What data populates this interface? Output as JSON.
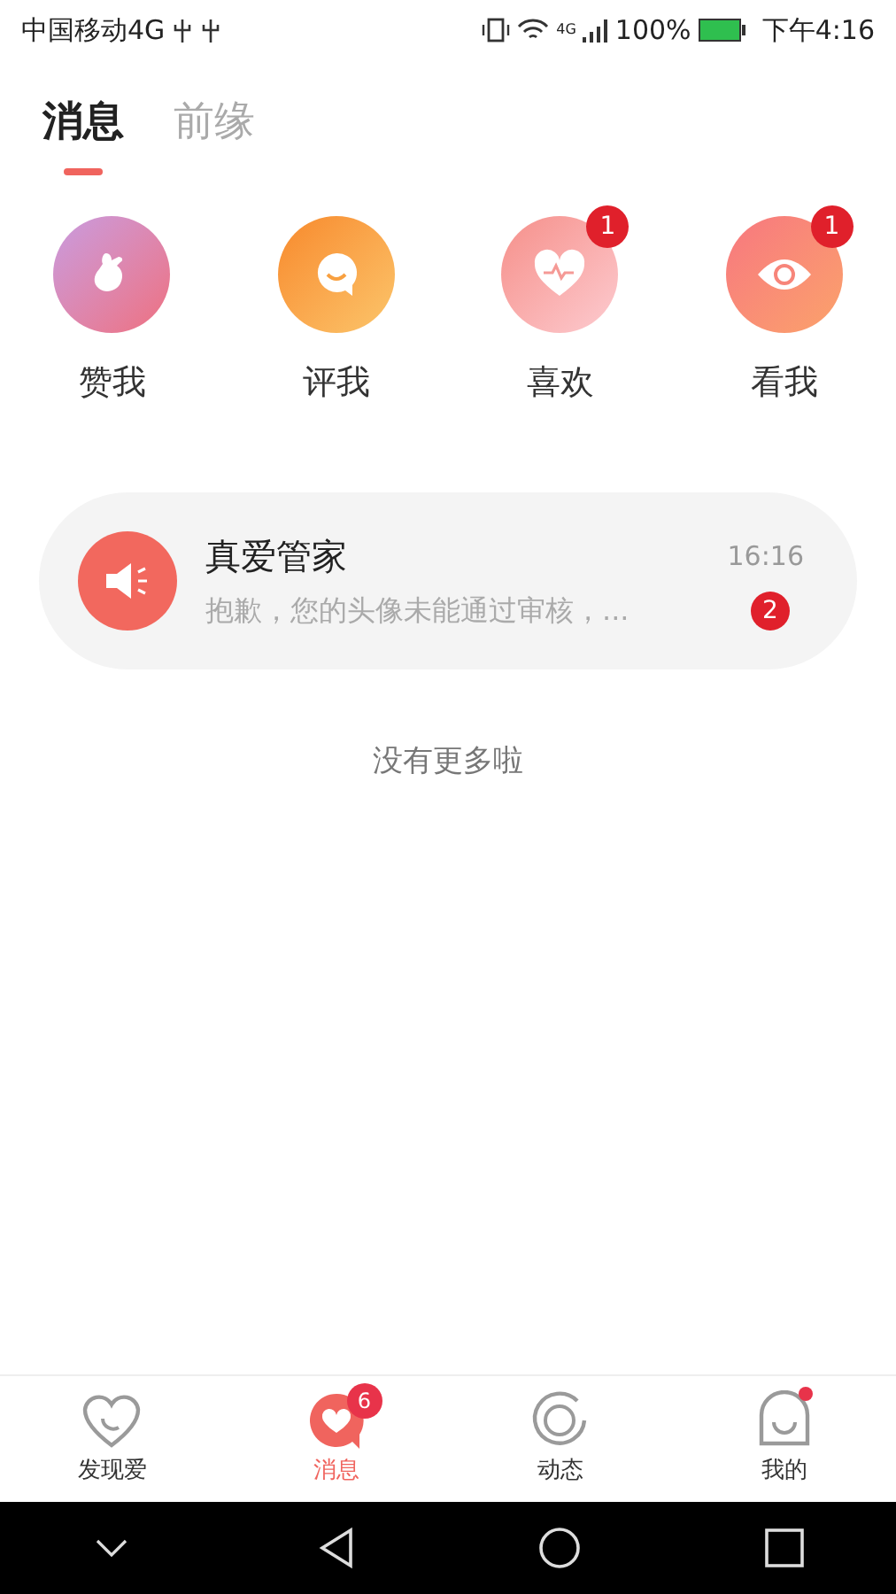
{
  "status_bar": {
    "carrier": "中国移动4G",
    "network": "4G",
    "battery": "100%",
    "time": "下午4:16"
  },
  "tabs": [
    {
      "label": "消息",
      "selected": true
    },
    {
      "label": "前缘",
      "selected": false
    }
  ],
  "shortcuts": [
    {
      "kind": "like",
      "label": "赞我"
    },
    {
      "kind": "comment",
      "label": "评我"
    },
    {
      "kind": "love",
      "label": "喜欢",
      "badge": "1"
    },
    {
      "kind": "view",
      "label": "看我",
      "badge": "1"
    }
  ],
  "conversations": [
    {
      "name": "真爱管家",
      "preview": "抱歉，您的头像未能通过审核，...",
      "time": "16:16",
      "unread": "2"
    }
  ],
  "end_note": "没有更多啦",
  "bottom_nav": [
    {
      "kind": "discover",
      "label": "发现爱",
      "selected": false
    },
    {
      "kind": "messages",
      "label": "消息",
      "selected": true,
      "badge": "6"
    },
    {
      "kind": "moments",
      "label": "动态",
      "selected": false
    },
    {
      "kind": "me",
      "label": "我的",
      "selected": false,
      "dot": true
    }
  ]
}
